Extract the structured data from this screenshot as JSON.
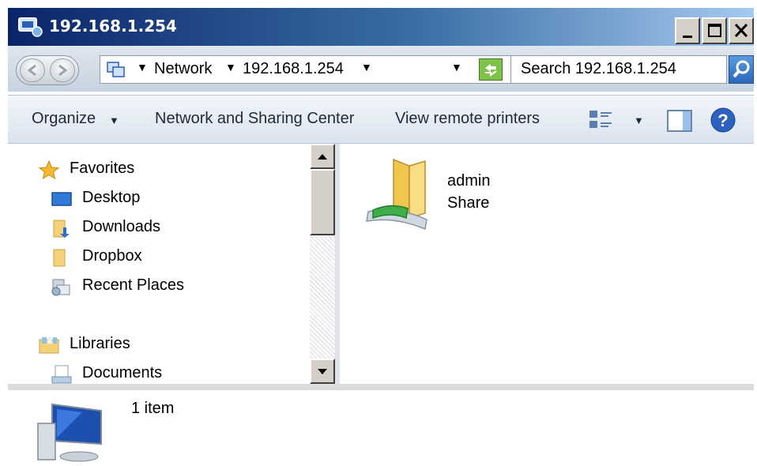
{
  "window": {
    "title": "192.168.1.254"
  },
  "address": {
    "crumbs": [
      "Network",
      "192.168.1.254"
    ],
    "search_placeholder": "Search 192.168.1.254"
  },
  "toolbar": {
    "organize": "Organize",
    "network_sharing": "Network and Sharing Center",
    "view_printers": "View remote printers"
  },
  "navpane": {
    "favorites_header": "Favorites",
    "favorites": [
      "Desktop",
      "Downloads",
      "Dropbox",
      "Recent Places"
    ],
    "libraries_header": "Libraries",
    "libraries": [
      "Documents"
    ]
  },
  "content": {
    "items": [
      {
        "name": "admin",
        "type": "Share"
      }
    ]
  },
  "details": {
    "count_text": "1 item"
  },
  "colors": {
    "titlebar_start": "#0a246a",
    "titlebar_end": "#a6caf0",
    "toolbar_bg": "#d9e3ee"
  }
}
